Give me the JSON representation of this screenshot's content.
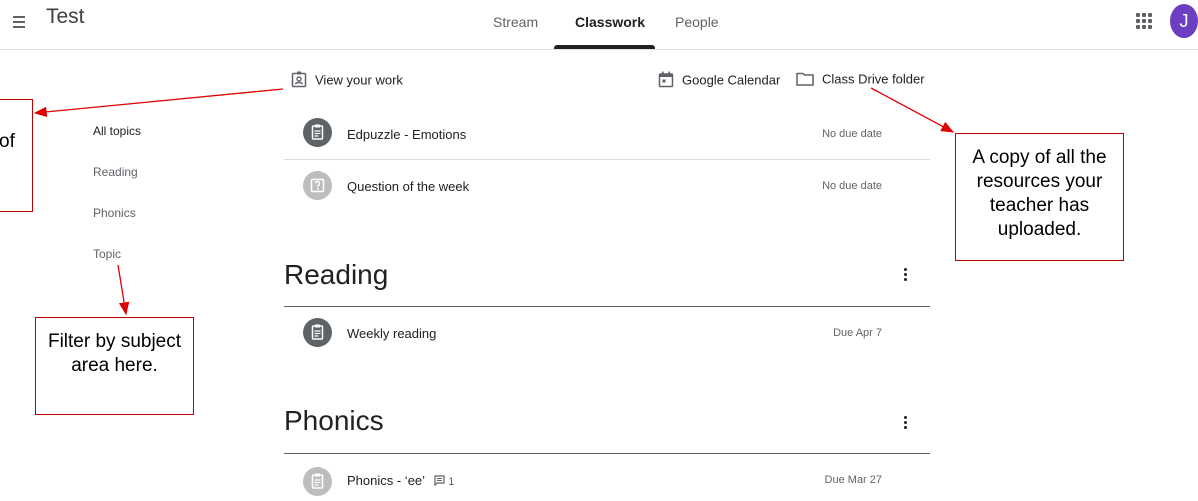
{
  "header": {
    "class_title": "Test",
    "tabs": [
      {
        "label": "Stream"
      },
      {
        "label": "Classwork"
      },
      {
        "label": "People"
      }
    ],
    "avatar_initial": "J"
  },
  "toolbar": {
    "view_work": "View your work",
    "calendar": "Google Calendar",
    "drive": "Class Drive folder"
  },
  "topics": [
    "All topics",
    "Reading",
    "Phonics",
    "Topic"
  ],
  "items": [
    {
      "title": "Edpuzzle - Emotions",
      "due": "No due date"
    },
    {
      "title": "Question of the week",
      "due": "No due date"
    }
  ],
  "sections": [
    {
      "title": "Reading",
      "items": [
        {
          "title": "Weekly reading",
          "due": "Due Apr 7"
        }
      ]
    },
    {
      "title": "Phonics",
      "items": [
        {
          "title": "Phonics - ‘ee’",
          "comments": "1",
          "due": "Due Mar 27"
        }
      ]
    }
  ],
  "callouts": {
    "left_partial": "of",
    "filter": "Filter by subject area here.",
    "drive": "A copy of all the resources your teacher has uploaded."
  },
  "colors": {
    "avatar": "#6c3fc1",
    "annotation": "#c00000"
  }
}
